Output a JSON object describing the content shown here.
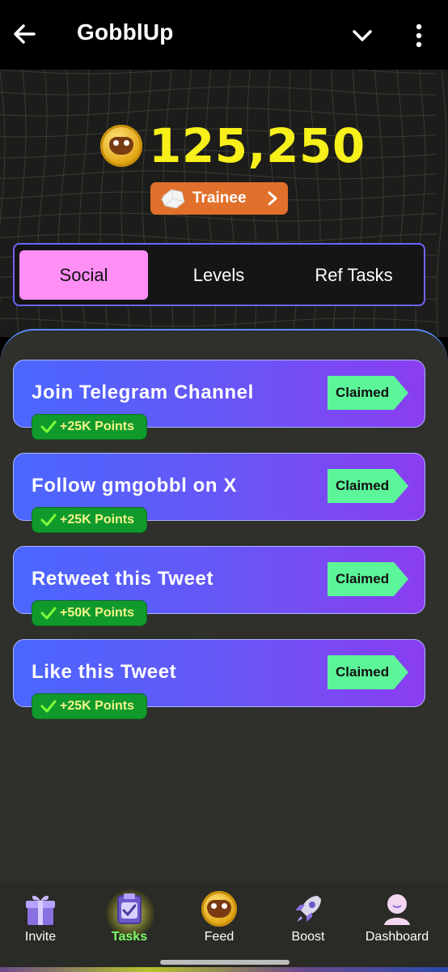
{
  "appbar": {
    "title": "GobblUp"
  },
  "balance": {
    "amount": "125,250"
  },
  "rank": {
    "label": "Trainee"
  },
  "tabs": [
    {
      "label": "Social",
      "active": true
    },
    {
      "label": "Levels",
      "active": false
    },
    {
      "label": "Ref Tasks",
      "active": false
    }
  ],
  "tasks": [
    {
      "name": "Join Telegram Channel",
      "status": "Claimed",
      "points": "+25K Points"
    },
    {
      "name": "Follow gmgobbl on X",
      "status": "Claimed",
      "points": "+25K Points"
    },
    {
      "name": "Retweet this Tweet",
      "status": "Claimed",
      "points": "+50K Points"
    },
    {
      "name": "Like this Tweet",
      "status": "Claimed",
      "points": "+25K Points"
    }
  ],
  "bottom_nav": [
    {
      "label": "Invite",
      "icon": "gift-icon",
      "active": false
    },
    {
      "label": "Tasks",
      "icon": "clipboard-check-icon",
      "active": true
    },
    {
      "label": "Feed",
      "icon": "coin-icon",
      "active": false
    },
    {
      "label": "Boost",
      "icon": "rocket-icon",
      "active": false
    },
    {
      "label": "Dashboard",
      "icon": "avatar-icon",
      "active": false
    }
  ],
  "colors": {
    "balance": "#f7f01a",
    "rank_badge": "#e0702b",
    "active_tab": "#ff8ef5",
    "claimed_button": "#5cf59a",
    "points_badge": "#119a2c",
    "active_nav": "#7dff6a"
  }
}
